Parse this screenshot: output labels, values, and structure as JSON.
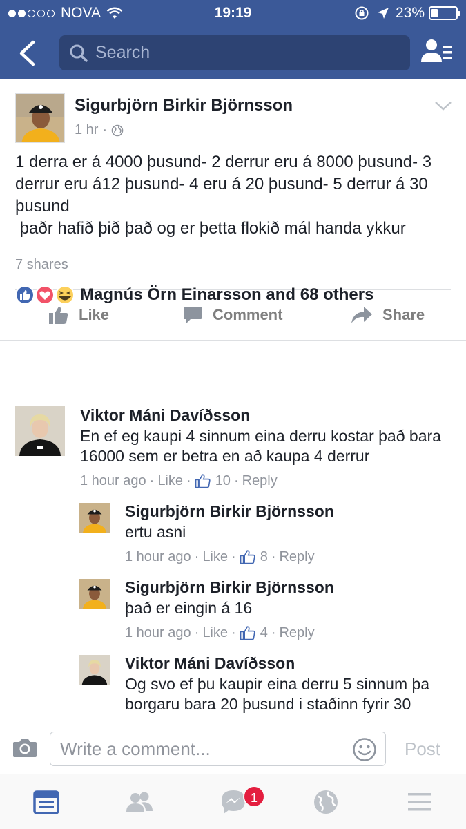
{
  "status_bar": {
    "carrier": "NOVA",
    "time": "19:19",
    "battery": "23%"
  },
  "header": {
    "search_placeholder": "Search"
  },
  "post": {
    "author": "Sigurbjörn Birkir Björnsson",
    "time": "1 hr",
    "text": "1 derra er á 4000 þusund- 2 derrur eru á 8000 þusund- 3 derrur eru á12 þusund- 4 eru á 20 þusund- 5 derrur á 30 þusund\n þaðr hafið þið það og er þetta flokið mál handa ykkur",
    "shares": "7 shares",
    "actions": {
      "like": "Like",
      "comment": "Comment",
      "share": "Share"
    },
    "reactions_text": "Magnús Örn Einarsson and 68 others"
  },
  "comments": [
    {
      "name": "Viktor Máni Davíðsson",
      "text": "En ef eg kaupi 4 sinnum eina derru kostar það bara 16000 sem er betra en að kaupa 4 derrur",
      "time": "1 hour ago",
      "like": "Like",
      "likes": "10",
      "reply": "Reply"
    },
    {
      "name": "Sigurbjörn Birkir Björnsson",
      "text": "ertu asni",
      "time": "1 hour ago",
      "like": "Like",
      "likes": "8",
      "reply": "Reply"
    },
    {
      "name": "Sigurbjörn Birkir Björnsson",
      "text": "það er eingin á 16",
      "time": "1 hour ago",
      "like": "Like",
      "likes": "4",
      "reply": "Reply"
    },
    {
      "name": "Viktor Máni Davíðsson",
      "text": "Og svo ef þu kaupir eina derru 5 sinnum þa borgaru bara 20 þusund i staðinn fyrir 30"
    }
  ],
  "composer": {
    "placeholder": "Write a comment...",
    "post_label": "Post"
  },
  "tabbar": {
    "messenger_badge": "1"
  },
  "colors": {
    "brand": "#3b5998",
    "search_bg": "#2d4373",
    "like_blue": "#4267b2",
    "love_red": "#f25268",
    "haha_yellow": "#fcd05b",
    "badge_red": "#e41e3f"
  },
  "icons": [
    "back-chevron-icon",
    "search-icon",
    "friend-requests-icon",
    "globe-icon",
    "chevron-down-icon",
    "thumbs-up-icon",
    "comment-icon",
    "share-arrow-icon",
    "like-reaction-icon",
    "love-reaction-icon",
    "haha-reaction-icon",
    "camera-icon",
    "smiley-icon",
    "news-feed-icon",
    "friends-icon",
    "messenger-icon",
    "notifications-globe-icon",
    "menu-icon"
  ]
}
